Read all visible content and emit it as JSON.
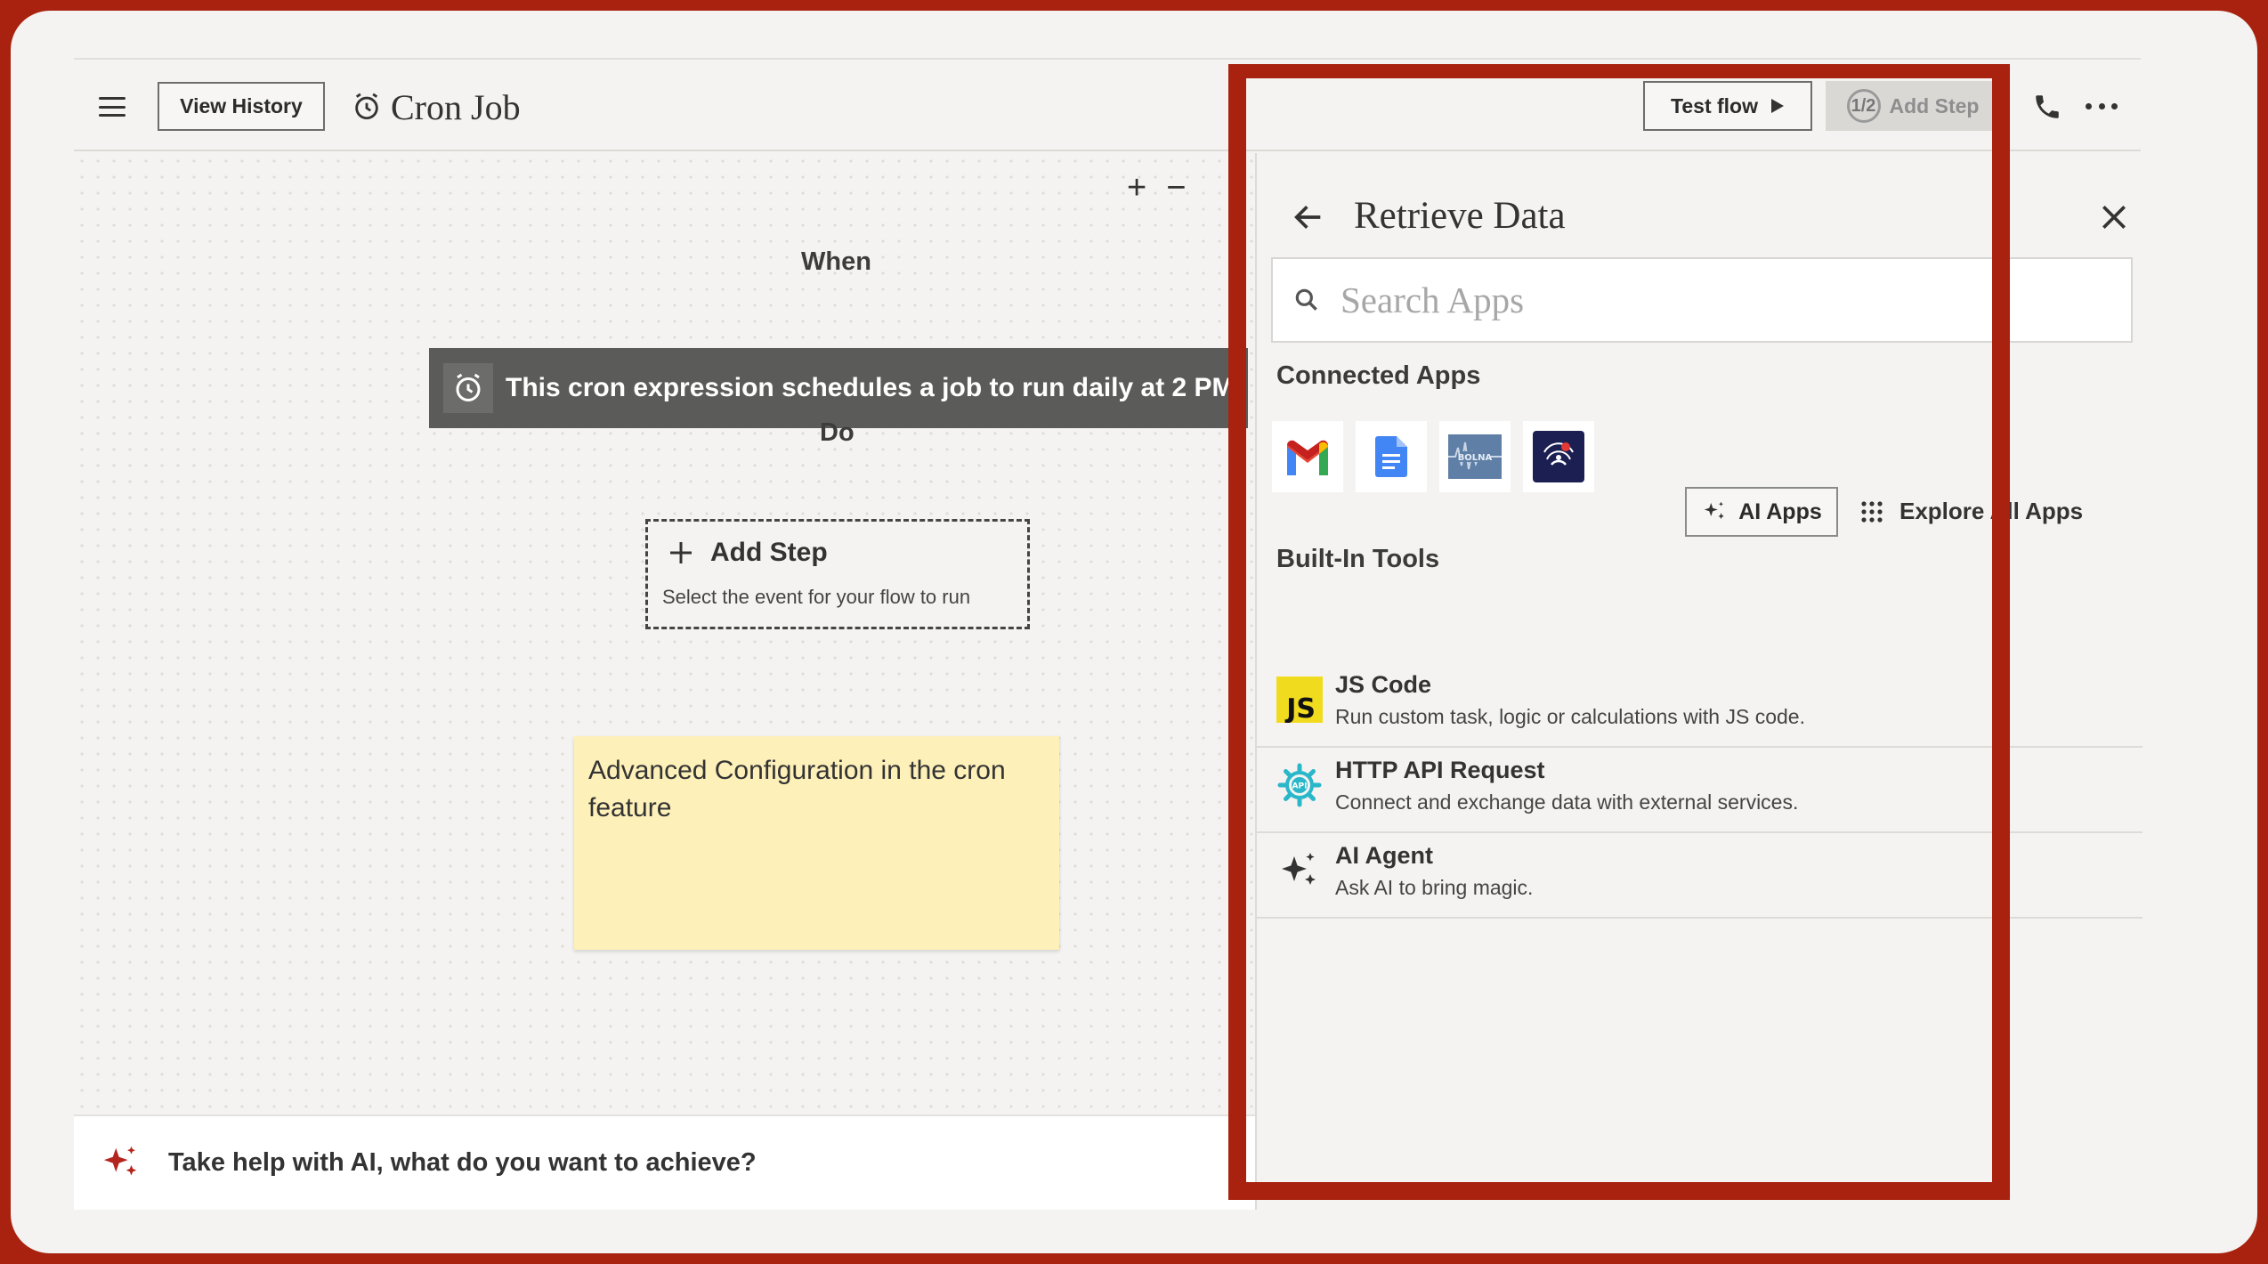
{
  "header": {
    "view_history_label": "View History",
    "title": "Cron Job",
    "test_flow_label": "Test flow",
    "add_step_label": "Add Step",
    "step_counter": "1/2"
  },
  "canvas": {
    "when_label": "When",
    "do_label": "Do",
    "trigger_text": "This cron expression schedules a job to run daily at 2 PM.",
    "add_step": {
      "title": "Add Step",
      "subtitle": "Select the event for your flow to run"
    },
    "sticky_note": "Advanced Configuration in the cron feature",
    "ai_prompt": "Take help with AI, what do you want to achieve?"
  },
  "panel": {
    "title": "Retrieve Data",
    "search_placeholder": "Search Apps",
    "connected_heading": "Connected Apps",
    "connected_apps": [
      {
        "icon": "gmail-icon"
      },
      {
        "icon": "google-docs-icon"
      },
      {
        "icon": "bolna-icon"
      },
      {
        "icon": "notification-app-icon"
      }
    ],
    "ai_apps_label": "AI Apps",
    "explore_label": "Explore All Apps",
    "builtin_heading": "Built-In Tools",
    "tools": [
      {
        "name": "JS Code",
        "desc": "Run custom task, logic or calculations with JS code.",
        "icon": "js-icon"
      },
      {
        "name": "HTTP API Request",
        "desc": "Connect and exchange data with external services.",
        "icon": "api-gear-icon"
      },
      {
        "name": "AI Agent",
        "desc": "Ask AI to bring magic.",
        "icon": "sparkle-icon"
      }
    ]
  },
  "colors": {
    "annotation": "#a8220f",
    "trigger_bg": "#5b5b59",
    "sticky": "#fdf0b9",
    "accent_red": "#b3261e"
  }
}
